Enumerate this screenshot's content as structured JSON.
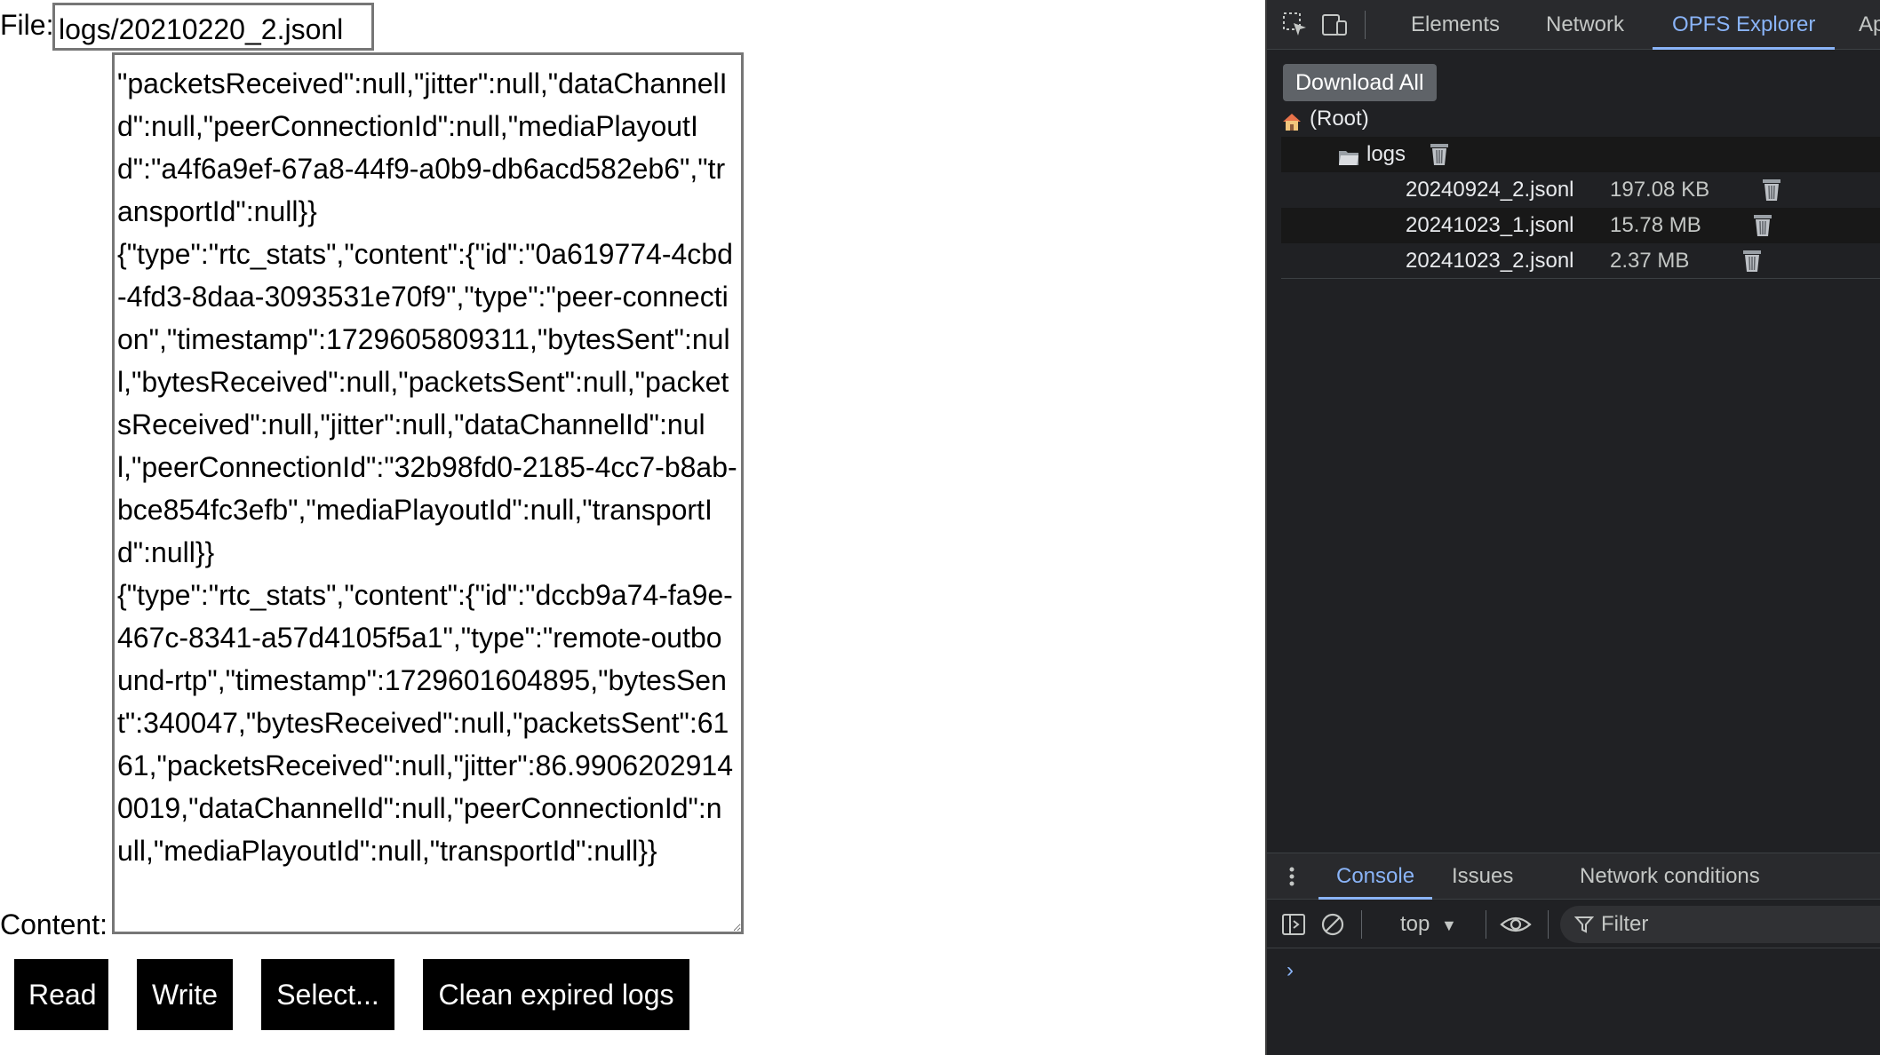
{
  "page": {
    "file_label": "File:",
    "file_value": "logs/20210220_2.jsonl",
    "content_label": "Content:",
    "content_value": "\"packetsReceived\":null,\"jitter\":null,\"dataChannelId\":null,\"peerConnectionId\":null,\"mediaPlayoutId\":\"a4f6a9ef-67a8-44f9-a0b9-db6acd582eb6\",\"transportId\":null}}\n{\"type\":\"rtc_stats\",\"content\":{\"id\":\"0a619774-4cbd-4fd3-8daa-3093531e70f9\",\"type\":\"peer-connection\",\"timestamp\":1729605809311,\"bytesSent\":null,\"bytesReceived\":null,\"packetsSent\":null,\"packetsReceived\":null,\"jitter\":null,\"dataChannelId\":null,\"peerConnectionId\":\"32b98fd0-2185-4cc7-b8ab-bce854fc3efb\",\"mediaPlayoutId\":null,\"transportId\":null}}\n{\"type\":\"rtc_stats\",\"content\":{\"id\":\"dccb9a74-fa9e-467c-8341-a57d4105f5a1\",\"type\":\"remote-outbound-rtp\",\"timestamp\":1729601604895,\"bytesSent\":340047,\"bytesReceived\":null,\"packetsSent\":6161,\"packetsReceived\":null,\"jitter\":86.99062029140019,\"dataChannelId\":null,\"peerConnectionId\":null,\"mediaPlayoutId\":null,\"transportId\":null}}",
    "buttons": {
      "read": "Read",
      "write": "Write",
      "select": "Select...",
      "clean": "Clean expired logs"
    }
  },
  "devtools": {
    "icons": [
      "inspect-element-icon",
      "device-toolbar-icon"
    ],
    "tabs": [
      "Elements",
      "Network",
      "OPFS Explorer",
      "Ap"
    ],
    "active_tab": "OPFS Explorer",
    "opfs": {
      "download_all": "Download All",
      "root_label": "(Root)",
      "folder": "logs",
      "files": [
        {
          "name": "20240924_2.jsonl",
          "size": "197.08 KB"
        },
        {
          "name": "20241023_1.jsonl",
          "size": "15.78 MB"
        },
        {
          "name": "20241023_2.jsonl",
          "size": "2.37 MB"
        }
      ]
    },
    "drawer": {
      "tabs": [
        "Console",
        "Issues",
        "Network conditions"
      ],
      "active_tab": "Console",
      "context": "top",
      "filter_placeholder": "Filter",
      "prompt": "›"
    },
    "colors": {
      "background": "#202124",
      "accent": "#8ab4f8",
      "button": "#5f6368"
    }
  }
}
